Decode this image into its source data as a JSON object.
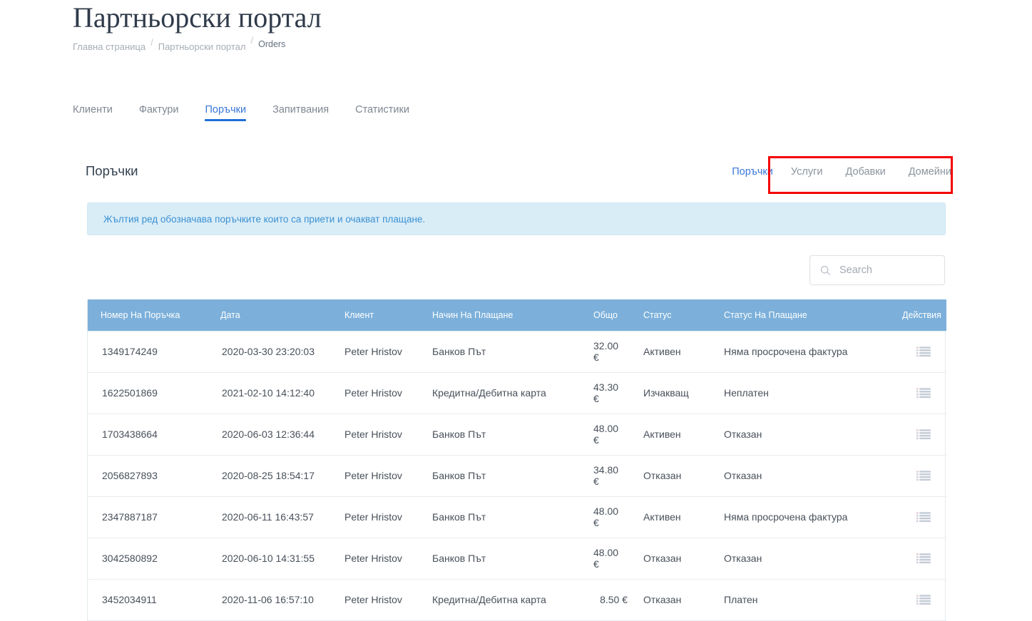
{
  "header": {
    "title": "Партньорски портал",
    "breadcrumb": [
      {
        "label": "Главна страница",
        "current": false
      },
      {
        "label": "Партньорски портал",
        "current": false
      },
      {
        "label": "Orders",
        "current": true
      }
    ],
    "separator": "/"
  },
  "tabs": [
    {
      "label": "Клиенти",
      "active": false
    },
    {
      "label": "Фактури",
      "active": false
    },
    {
      "label": "Поръчки",
      "active": true
    },
    {
      "label": "Запитвания",
      "active": false
    },
    {
      "label": "Статистики",
      "active": false
    }
  ],
  "card": {
    "title": "Поръчки",
    "subnav": [
      {
        "label": "Поръчки",
        "style": "link"
      },
      {
        "label": "Услуги",
        "style": "muted"
      },
      {
        "label": "Добавки",
        "style": "muted"
      },
      {
        "label": "Домейни",
        "style": "muted"
      }
    ],
    "alert": "Жълтия ред обозначава поръчките които са приети и очакват плащане.",
    "highlight_color": "#f40000"
  },
  "search": {
    "placeholder": "Search",
    "value": "",
    "icon": "search-icon"
  },
  "table": {
    "header_bg": "#7cb0da",
    "columns": [
      "Номер На Поръчка",
      "Дата",
      "Клиент",
      "Начин На Плащане",
      "Общо",
      "Статус",
      "Статус На Плащане",
      "Действия"
    ],
    "rows": [
      {
        "order_no": "1349174249",
        "date": "2020-03-30 23:20:03",
        "client": "Peter Hristov",
        "payment_method": "Банков Път",
        "total": "32.00 €",
        "status": "Активен",
        "payment_status": "Няма просрочена фактура",
        "action_icon": "list-icon"
      },
      {
        "order_no": "1622501869",
        "date": "2021-02-10 14:12:40",
        "client": "Peter Hristov",
        "payment_method": "Кредитна/Дебитна карта",
        "total": "43.30 €",
        "status": "Изчакващ",
        "payment_status": "Неплатен",
        "action_icon": "list-icon"
      },
      {
        "order_no": "1703438664",
        "date": "2020-06-03 12:36:44",
        "client": "Peter Hristov",
        "payment_method": "Банков Път",
        "total": "48.00 €",
        "status": "Активен",
        "payment_status": "Отказан",
        "action_icon": "list-icon"
      },
      {
        "order_no": "2056827893",
        "date": "2020-08-25 18:54:17",
        "client": "Peter Hristov",
        "payment_method": "Банков Път",
        "total": "34.80 €",
        "status": "Отказан",
        "payment_status": "Отказан",
        "action_icon": "list-icon"
      },
      {
        "order_no": "2347887187",
        "date": "2020-06-11 16:43:57",
        "client": "Peter Hristov",
        "payment_method": "Банков Път",
        "total": "48.00 €",
        "status": "Активен",
        "payment_status": "Няма просрочена фактура",
        "action_icon": "list-icon"
      },
      {
        "order_no": "3042580892",
        "date": "2020-06-10 14:31:55",
        "client": "Peter Hristov",
        "payment_method": "Банков Път",
        "total": "48.00 €",
        "status": "Отказан",
        "payment_status": "Отказан",
        "action_icon": "list-icon"
      },
      {
        "order_no": "3452034911",
        "date": "2020-11-06 16:57:10",
        "client": "Peter Hristov",
        "payment_method": "Кредитна/Дебитна карта",
        "total": "8.50 €",
        "status": "Отказан",
        "payment_status": "Платен",
        "action_icon": "list-icon"
      }
    ]
  }
}
